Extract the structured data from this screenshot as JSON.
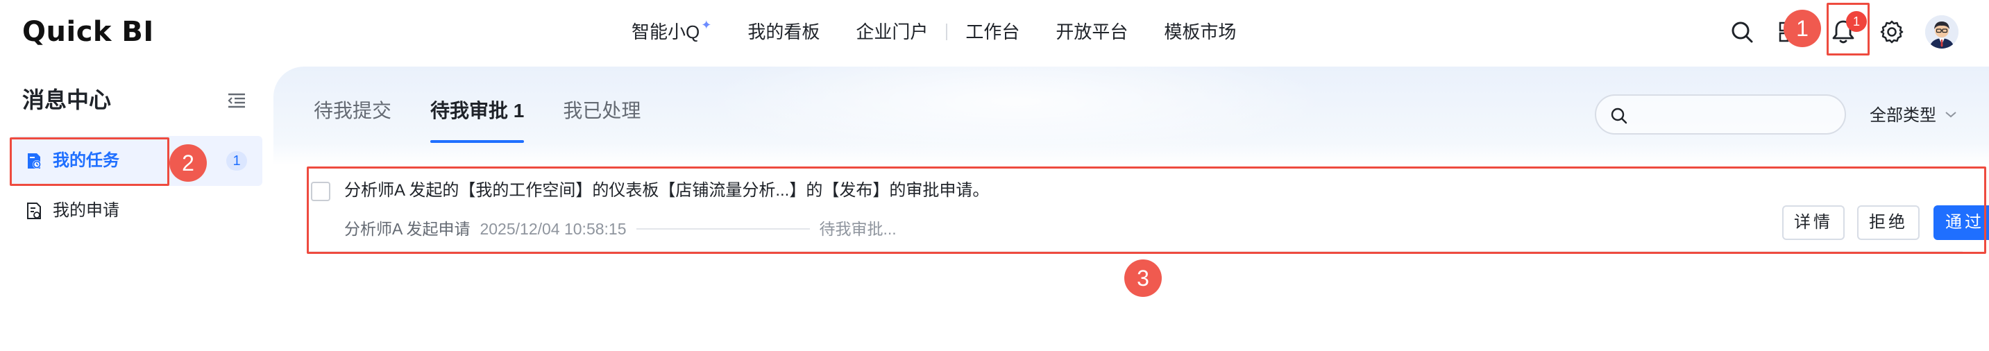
{
  "app": {
    "logo_text": "Quick BI"
  },
  "nav": {
    "items": [
      {
        "label": "智能小Q"
      },
      {
        "label": "我的看板"
      },
      {
        "label": "企业门户"
      },
      {
        "label": "工作台"
      },
      {
        "label": "开放平台"
      },
      {
        "label": "模板市场"
      }
    ],
    "notification_count": "1"
  },
  "sidebar": {
    "title": "消息中心",
    "items": [
      {
        "label": "我的任务",
        "count": "1",
        "active": true,
        "icon": "task-icon"
      },
      {
        "label": "我的申请",
        "active": false,
        "icon": "application-icon"
      }
    ]
  },
  "tabs": [
    {
      "label": "待我提交",
      "active": false
    },
    {
      "label": "待我审批 1",
      "active": true
    },
    {
      "label": "我已处理",
      "active": false
    }
  ],
  "search": {
    "placeholder": ""
  },
  "filter": {
    "label": "全部类型"
  },
  "tasks": [
    {
      "title": "分析师A 发起的【我的工作空间】的仪表板【店铺流量分析...】的【发布】的审批申请。",
      "requester": "分析师A 发起申请",
      "time": "2025/12/04 10:58:15",
      "status": "待我审批...",
      "actions": {
        "details": "详情",
        "reject": "拒绝",
        "approve": "通过"
      }
    }
  ],
  "annotations": {
    "callout_1": "1",
    "callout_2": "2",
    "callout_3": "3"
  },
  "colors": {
    "accent": "#1f6fff",
    "annotation": "#ee4b3f",
    "badge": "#f0443c"
  }
}
